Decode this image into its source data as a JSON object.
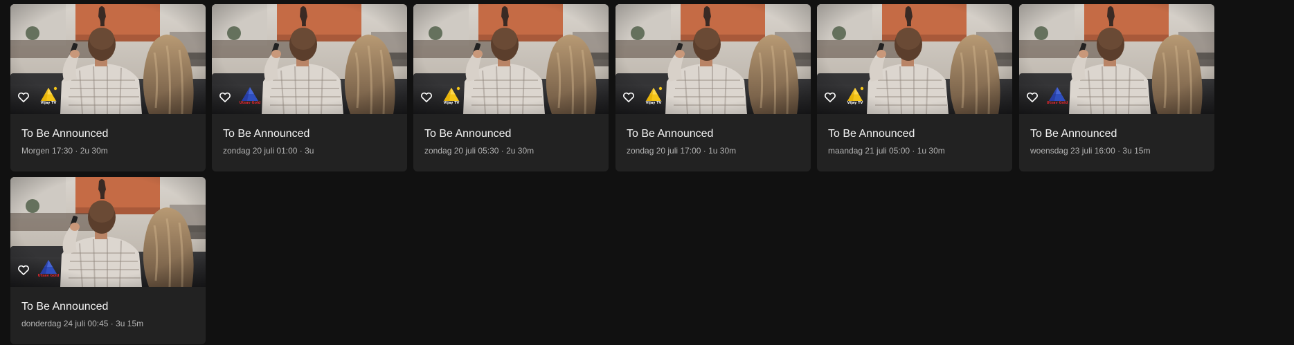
{
  "programs": [
    {
      "title": "To Be Announced",
      "meta": "Morgen 17:30 · 2u 30m",
      "channel": "Vijay TV",
      "channel_logo": "vijay-tv-logo"
    },
    {
      "title": "To Be Announced",
      "meta": "zondag 20 juli 01:00 · 3u",
      "channel": "Utsav Gold",
      "channel_logo": "utsav-gold-logo"
    },
    {
      "title": "To Be Announced",
      "meta": "zondag 20 juli 05:30 · 2u 30m",
      "channel": "Vijay TV",
      "channel_logo": "vijay-tv-logo"
    },
    {
      "title": "To Be Announced",
      "meta": "zondag 20 juli 17:00 · 1u 30m",
      "channel": "Vijay TV",
      "channel_logo": "vijay-tv-logo"
    },
    {
      "title": "To Be Announced",
      "meta": "maandag 21 juli 05:00 · 1u 30m",
      "channel": "Vijay TV",
      "channel_logo": "vijay-tv-logo"
    },
    {
      "title": "To Be Announced",
      "meta": "woensdag 23 juli 16:00 · 3u 15m",
      "channel": "Utsav Gold",
      "channel_logo": "utsav-gold-logo"
    },
    {
      "title": "To Be Announced",
      "meta": "donderdag 24 juli 00:45 · 3u 15m",
      "channel": "Utsav Gold",
      "channel_logo": "utsav-gold-logo"
    }
  ],
  "icons": {
    "favorite": "heart-outline-icon"
  },
  "colors": {
    "background": "#111111",
    "card": "#222222",
    "title_text": "#f2f2f2",
    "meta_text": "#b4b4b4",
    "vijay_yellow": "#f5c518",
    "utsav_blue": "#2f4fbf",
    "utsav_red": "#e0262e"
  }
}
